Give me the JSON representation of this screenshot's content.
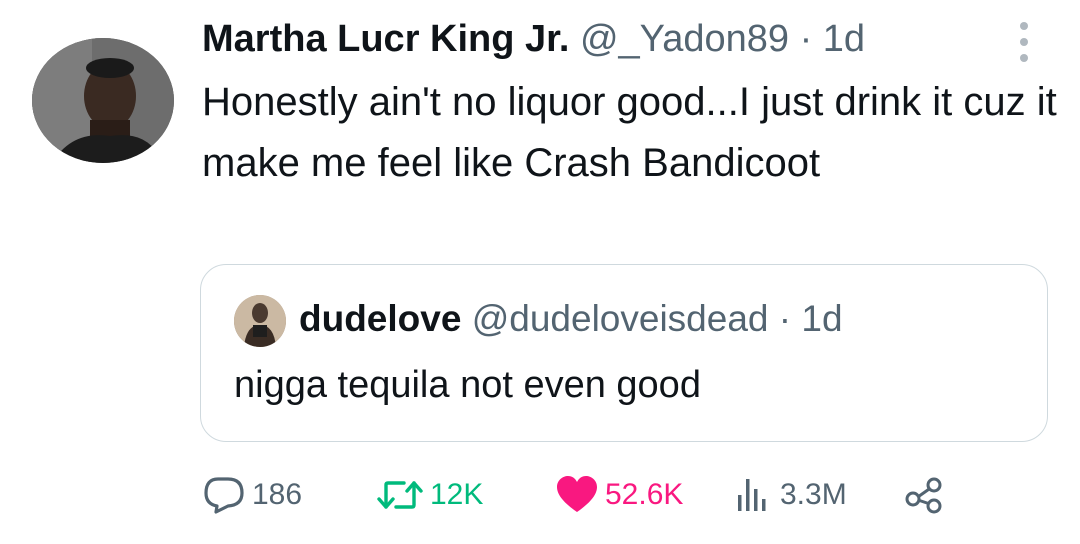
{
  "tweet": {
    "display_name": "Martha Lucr King Jr.",
    "handle": "@_Yadon89",
    "separator": "·",
    "time": "1d",
    "text": "Honestly ain't no liquor good...I just drink it cuz it make me feel like Crash Bandicoot"
  },
  "quote": {
    "display_name": "dudelove",
    "handle": "@dudeloveisdead",
    "separator": "·",
    "time": "1d",
    "text": "nigga tequila not even good"
  },
  "actions": {
    "replies": "186",
    "retweets": "12K",
    "likes": "52.6K",
    "views": "3.3M"
  },
  "colors": {
    "text_primary": "#0f1419",
    "text_secondary": "#536471",
    "retweet_green": "#00ba7c",
    "like_pink": "#f91880",
    "border": "#cfd9de"
  },
  "icons": {
    "reply": "comment-bubble-icon",
    "retweet": "retweet-arrows-icon",
    "like": "heart-filled-icon",
    "views": "bar-chart-icon",
    "share": "share-nodes-icon",
    "more": "more-vertical-icon"
  }
}
